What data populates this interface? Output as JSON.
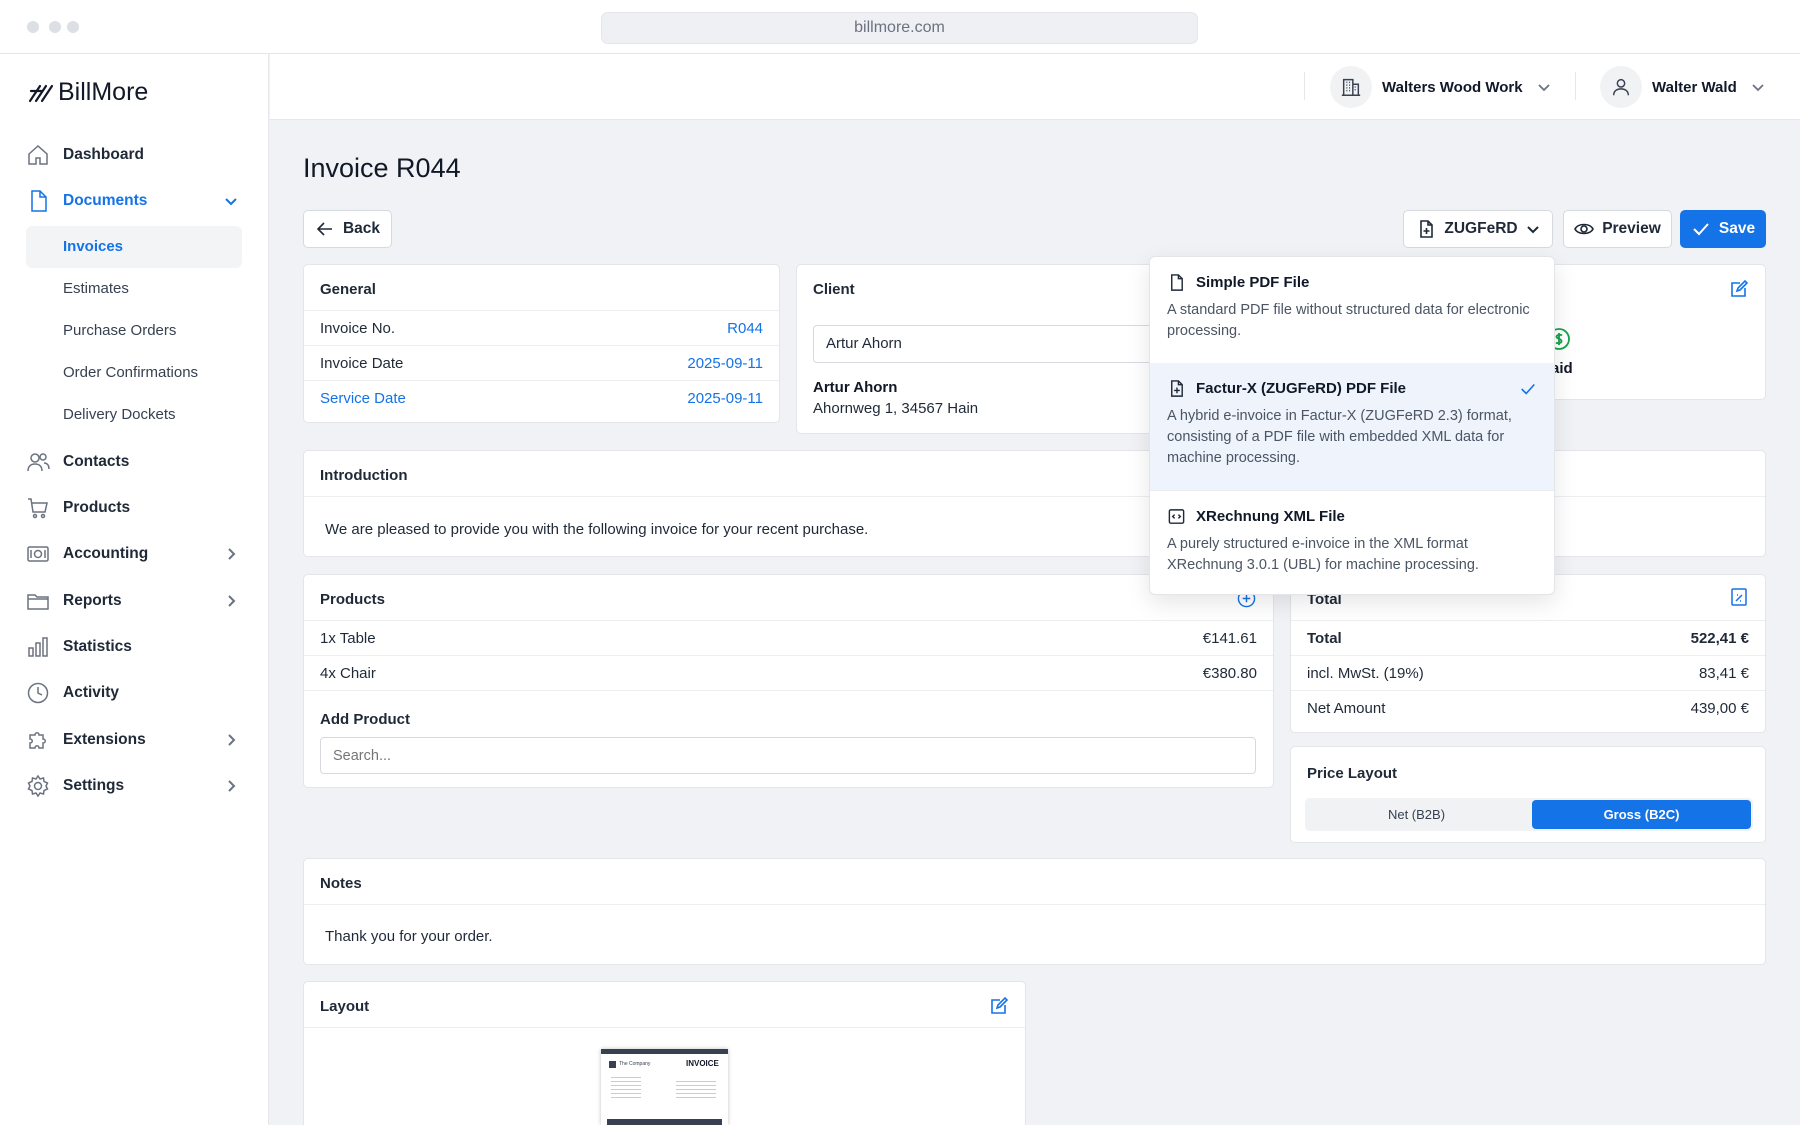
{
  "browser": {
    "url": "billmore.com"
  },
  "app": {
    "name": "BillMore"
  },
  "sidebar": {
    "items": [
      {
        "label": "Dashboard",
        "icon": "home-icon"
      },
      {
        "label": "Documents",
        "icon": "document-icon"
      },
      {
        "label": "Contacts",
        "icon": "users-icon"
      },
      {
        "label": "Products",
        "icon": "cart-icon"
      },
      {
        "label": "Accounting",
        "icon": "money-icon"
      },
      {
        "label": "Reports",
        "icon": "folder-icon"
      },
      {
        "label": "Statistics",
        "icon": "bar-chart-icon"
      },
      {
        "label": "Activity",
        "icon": "clock-icon"
      },
      {
        "label": "Extensions",
        "icon": "puzzle-icon"
      },
      {
        "label": "Settings",
        "icon": "gear-icon"
      }
    ],
    "documents_sub": [
      "Invoices",
      "Estimates",
      "Purchase Orders",
      "Order Confirmations",
      "Delivery Dockets"
    ]
  },
  "topbar": {
    "company": "Walters Wood Work",
    "user": "Walter Wald"
  },
  "page": {
    "title": "Invoice R044"
  },
  "toolbar": {
    "back": "Back",
    "format": "ZUGFeRD",
    "preview": "Preview",
    "save": "Save"
  },
  "general": {
    "heading": "General",
    "rows": [
      {
        "label": "Invoice No.",
        "value": "R044"
      },
      {
        "label": "Invoice Date",
        "value": "2025-09-11"
      },
      {
        "label": "Service Date",
        "value": "2025-09-11"
      }
    ]
  },
  "client": {
    "heading": "Client",
    "selected": "Artur Ahorn",
    "name": "Artur Ahorn",
    "address": "Ahornweg 1, 34567 Hain"
  },
  "status": {
    "partial_label": "aid"
  },
  "introduction": {
    "heading": "Introduction",
    "text": "We are pleased to provide you with the following invoice for your recent purchase."
  },
  "products": {
    "heading": "Products",
    "items": [
      {
        "label": "1x Table",
        "price": "€141.61"
      },
      {
        "label": "4x Chair",
        "price": "€380.80"
      }
    ],
    "add_label": "Add Product",
    "search_placeholder": "Search..."
  },
  "total": {
    "heading": "Total",
    "rows": [
      {
        "label": "Total",
        "value": "522,41 €"
      },
      {
        "label": "incl. MwSt. (19%)",
        "value": "83,41 €"
      },
      {
        "label": "Net Amount",
        "value": "439,00 €"
      }
    ]
  },
  "price_layout": {
    "heading": "Price Layout",
    "options": [
      "Net (B2B)",
      "Gross (B2C)"
    ],
    "selected": "Gross (B2C)"
  },
  "notes": {
    "heading": "Notes",
    "text": "Thank you for your order."
  },
  "layout": {
    "heading": "Layout",
    "thumb_company": "The Company",
    "thumb_title": "INVOICE"
  },
  "dropdown": {
    "options": [
      {
        "title": "Simple PDF File",
        "desc": "A standard PDF file without structured data for electronic processing."
      },
      {
        "title": "Factur-X (ZUGFeRD) PDF File",
        "desc": "A hybrid e-invoice in Factur-X (ZUGFeRD 2.3) format, consisting of a PDF file with embedded XML data for machine processing."
      },
      {
        "title": "XRechnung XML File",
        "desc": "A purely structured e-invoice in the XML format XRechnung 3.0.1 (UBL) for machine processing."
      }
    ],
    "selected_index": 1
  },
  "colors": {
    "accent": "#1473e6",
    "success": "#16a34a",
    "page_bg": "#f1f2f5"
  }
}
